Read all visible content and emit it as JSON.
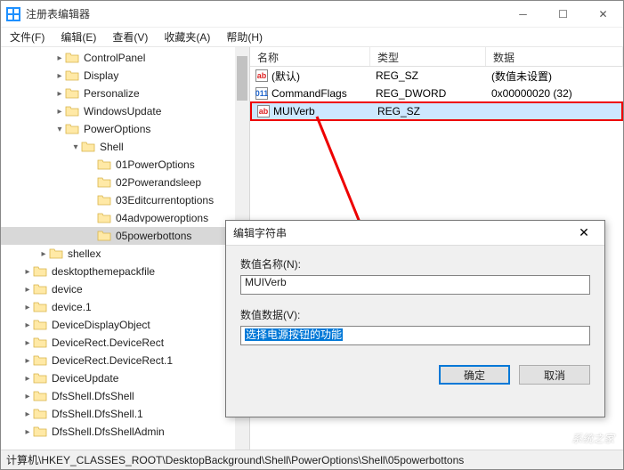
{
  "window": {
    "title": "注册表编辑器"
  },
  "menu": {
    "file": "文件(F)",
    "edit": "编辑(E)",
    "view": "查看(V)",
    "favorites": "收藏夹(A)",
    "help": "帮助(H)"
  },
  "tree": {
    "items": [
      {
        "indent": 3,
        "caret": ">",
        "label": "ControlPanel"
      },
      {
        "indent": 3,
        "caret": ">",
        "label": "Display"
      },
      {
        "indent": 3,
        "caret": ">",
        "label": "Personalize"
      },
      {
        "indent": 3,
        "caret": ">",
        "label": "WindowsUpdate"
      },
      {
        "indent": 3,
        "caret": "v",
        "label": "PowerOptions"
      },
      {
        "indent": 4,
        "caret": "v",
        "label": "Shell"
      },
      {
        "indent": 5,
        "caret": "",
        "label": "01PowerOptions"
      },
      {
        "indent": 5,
        "caret": "",
        "label": "02Powerandsleep"
      },
      {
        "indent": 5,
        "caret": "",
        "label": "03Editcurrentoptions"
      },
      {
        "indent": 5,
        "caret": "",
        "label": "04advpoweroptions"
      },
      {
        "indent": 5,
        "caret": "",
        "label": "05powerbottons",
        "selected": true
      },
      {
        "indent": 2,
        "caret": ">",
        "label": "shellex"
      },
      {
        "indent": 1,
        "caret": ">",
        "label": "desktopthemepackfile"
      },
      {
        "indent": 1,
        "caret": ">",
        "label": "device"
      },
      {
        "indent": 1,
        "caret": ">",
        "label": "device.1"
      },
      {
        "indent": 1,
        "caret": ">",
        "label": "DeviceDisplayObject"
      },
      {
        "indent": 1,
        "caret": ">",
        "label": "DeviceRect.DeviceRect"
      },
      {
        "indent": 1,
        "caret": ">",
        "label": "DeviceRect.DeviceRect.1"
      },
      {
        "indent": 1,
        "caret": ">",
        "label": "DeviceUpdate"
      },
      {
        "indent": 1,
        "caret": ">",
        "label": "DfsShell.DfsShell"
      },
      {
        "indent": 1,
        "caret": ">",
        "label": "DfsShell.DfsShell.1"
      },
      {
        "indent": 1,
        "caret": ">",
        "label": "DfsShell.DfsShellAdmin"
      }
    ]
  },
  "list": {
    "headers": {
      "name": "名称",
      "type": "类型",
      "data": "数据"
    },
    "rows": [
      {
        "icon": "str",
        "name": "(默认)",
        "type": "REG_SZ",
        "data": "(数值未设置)"
      },
      {
        "icon": "bin",
        "name": "CommandFlags",
        "type": "REG_DWORD",
        "data": "0x00000020 (32)"
      },
      {
        "icon": "str",
        "name": "MUIVerb",
        "type": "REG_SZ",
        "data": "",
        "highlight": true
      }
    ]
  },
  "dialog": {
    "title": "编辑字符串",
    "nameLabel": "数值名称(N):",
    "nameValue": "MUIVerb",
    "dataLabel": "数值数据(V):",
    "dataValue": "选择电源按钮的功能",
    "ok": "确定",
    "cancel": "取消"
  },
  "statusbar": {
    "path": "计算机\\HKEY_CLASSES_ROOT\\DesktopBackground\\Shell\\PowerOptions\\Shell\\05powerbottons"
  },
  "watermark": {
    "text": "系统之家"
  }
}
